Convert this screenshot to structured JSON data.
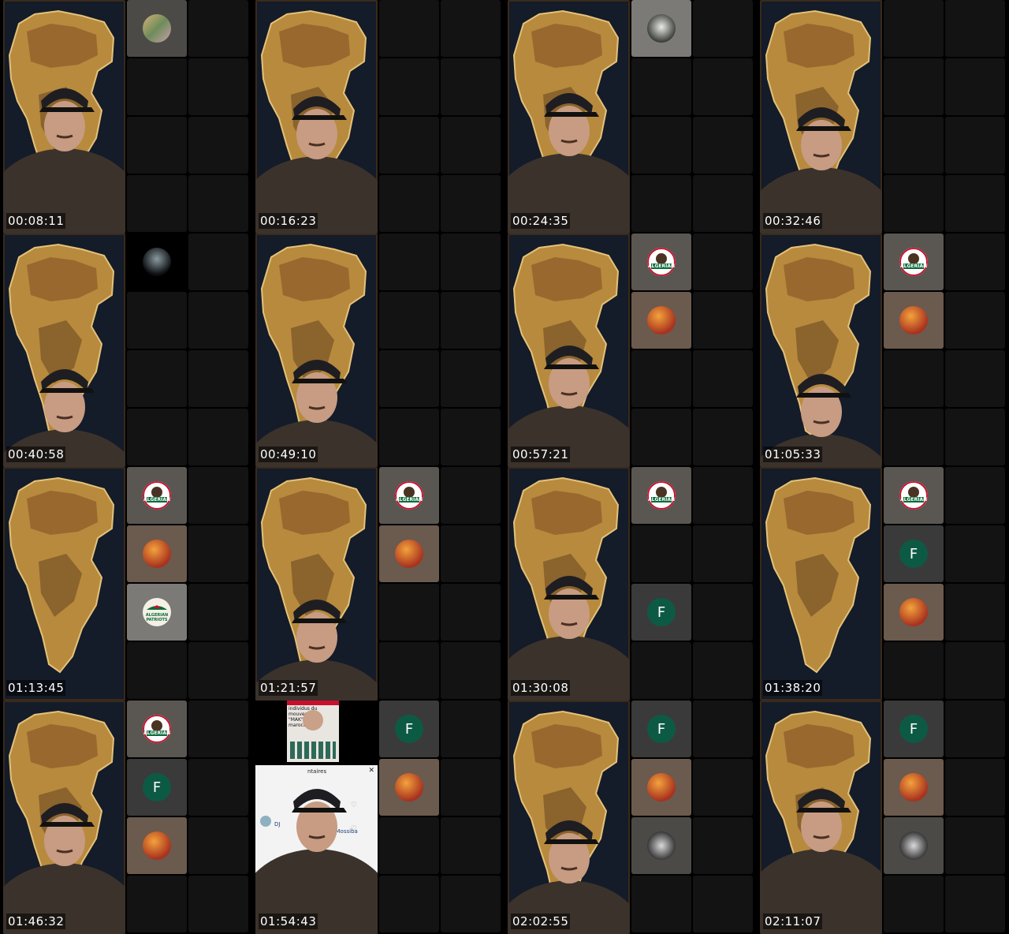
{
  "timestamps": [
    "00:08:11",
    "00:16:23",
    "00:24:35",
    "00:32:46",
    "00:40:58",
    "00:49:10",
    "00:57:21",
    "01:05:33",
    "01:13:45",
    "01:21:57",
    "01:30:08",
    "01:38:20",
    "01:46:32",
    "01:54:43",
    "02:02:55",
    "02:11:07"
  ],
  "avatar_letter": "F",
  "badge_text": [
    "ALGERIAN",
    "ALGERIAN",
    "PATRIOTS"
  ],
  "overlay": {
    "post_lines": [
      "individus du",
      "mouveme",
      "\"MAK\" d",
      "marocai"
    ],
    "comments_header": "ntaires",
    "comment_line_1": "bent \"TAHIA",
    "comment_line_2": "DJ",
    "comment_line_3": "wahrania @Mossiba"
  },
  "colors": {
    "f_avatar": "#0d5a44",
    "tile_bg": "#131313"
  }
}
